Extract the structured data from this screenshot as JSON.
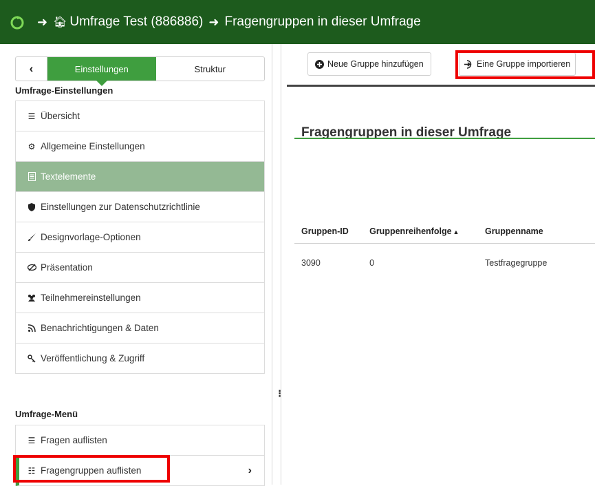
{
  "breadcrumb": {
    "survey": "Umfrage Test (886886)",
    "page": "Fragengruppen in dieser Umfrage"
  },
  "sidebar": {
    "tabs": [
      "Einstellungen",
      "Struktur"
    ],
    "settings_title": "Umfrage-Einstellungen",
    "settings_items": [
      {
        "label": "Übersicht",
        "icon": "list-icon"
      },
      {
        "label": "Allgemeine Einstellungen",
        "icon": "cogs-icon"
      },
      {
        "label": "Textelemente",
        "icon": "file-text-icon"
      },
      {
        "label": "Einstellungen zur Datenschutzrichtlinie",
        "icon": "shield-icon"
      },
      {
        "label": "Designvorlage-Optionen",
        "icon": "brush-icon"
      },
      {
        "label": "Präsentation",
        "icon": "eye-slash-icon"
      },
      {
        "label": "Teilnehmereinstellungen",
        "icon": "users-icon"
      },
      {
        "label": "Benachrichtigungen & Daten",
        "icon": "rss-icon"
      },
      {
        "label": "Veröffentlichung & Zugriff",
        "icon": "key-icon"
      }
    ],
    "menu_title": "Umfrage-Menü",
    "menu_items": [
      {
        "label": "Fragen auflisten",
        "icon": "list-icon"
      },
      {
        "label": "Fragengruppen auflisten",
        "icon": "list-ol-icon"
      }
    ]
  },
  "toolbar": {
    "add_group": "Neue Gruppe hinzufügen",
    "import_group": "Eine Gruppe importieren"
  },
  "main": {
    "title": "Fragengruppen in dieser Umfrage",
    "columns": [
      "Gruppen-ID",
      "Gruppenreihenfolge",
      "Gruppenname"
    ],
    "rows": [
      [
        "3090",
        "0",
        "Testfragegruppe"
      ]
    ]
  },
  "colors": {
    "header_bg": "#1d5b1d",
    "accent_green": "#3f9e3f",
    "active_item_bg": "#94b994",
    "highlight_red": "#ee0000"
  }
}
